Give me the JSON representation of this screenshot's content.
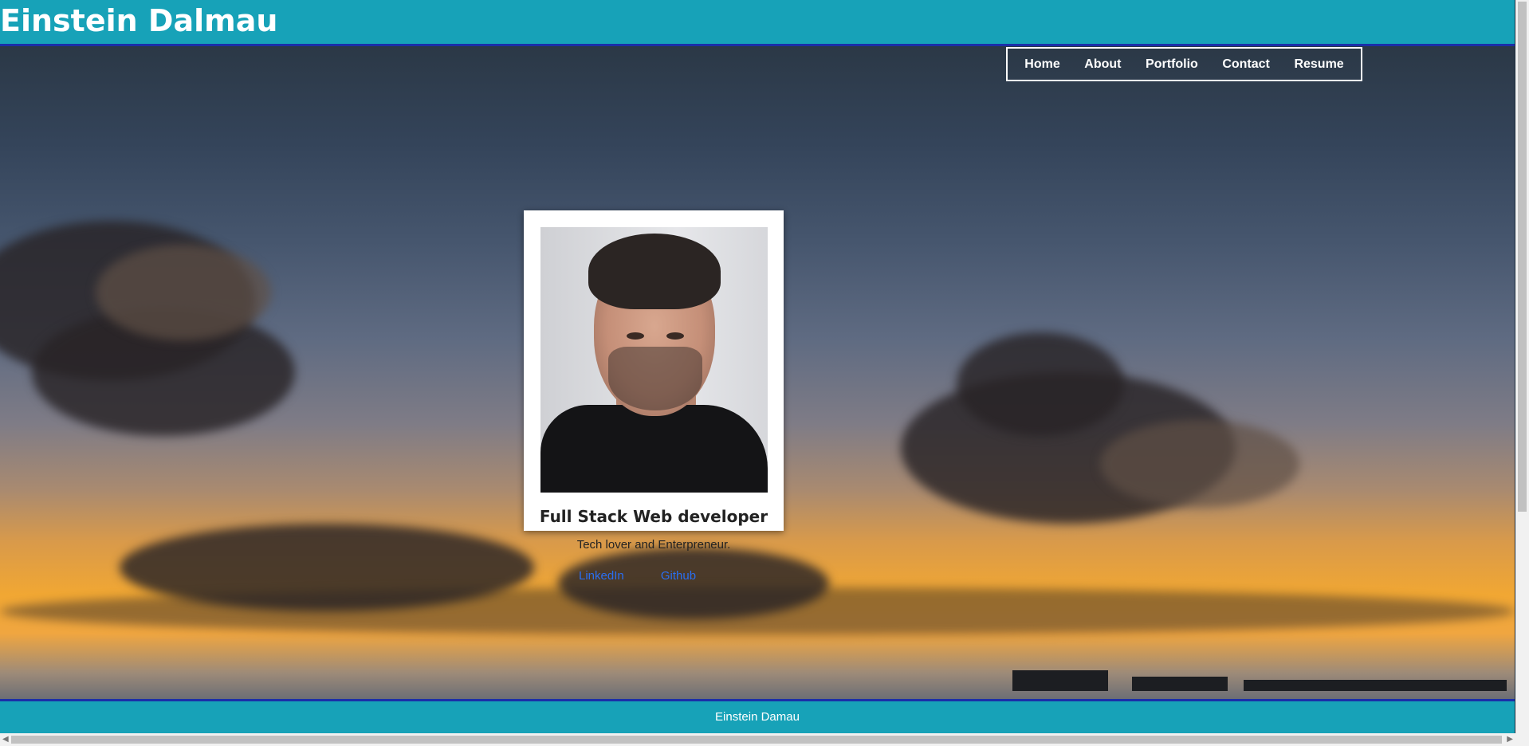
{
  "header": {
    "site_title": "Einstein Dalmau"
  },
  "nav": {
    "items": [
      "Home",
      "About",
      "Portfolio",
      "Contact",
      "Resume"
    ]
  },
  "profile": {
    "title": "Full Stack Web developer",
    "tagline": "Tech lover and Enterpreneur.",
    "links": [
      "LinkedIn",
      "Github"
    ]
  },
  "footer": {
    "text": "Einstein Damau"
  },
  "colors": {
    "header_bg": "#17a2b8",
    "header_border": "#1b2fa8",
    "link": "#2a6ef0"
  }
}
